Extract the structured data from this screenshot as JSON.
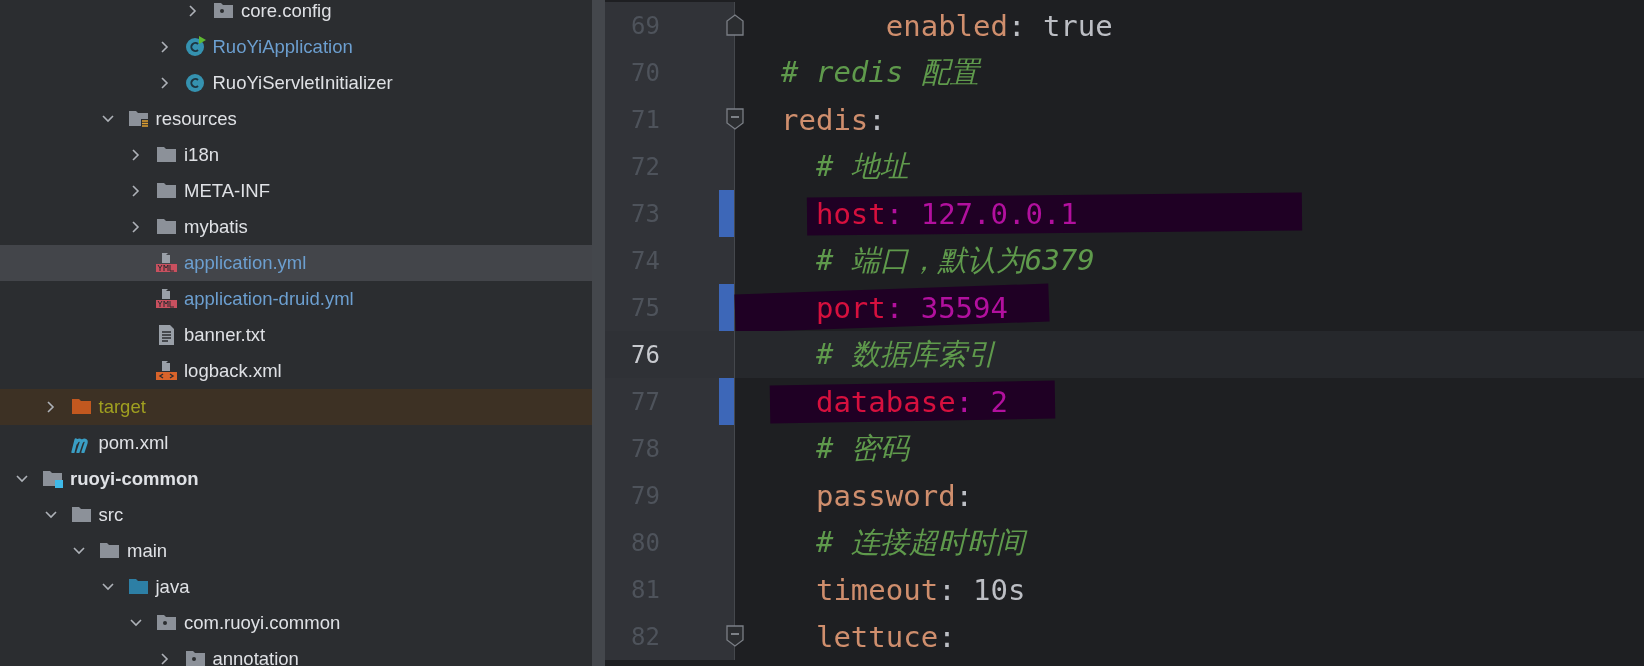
{
  "project_tree": {
    "items": [
      {
        "children": [
          {
            "children": [
              {
                "children": [
                  {
                    "children": [
                      {
                        "children": [
                          {
                            "children": [
                              {
                                "label": "core.config",
                                "kind": "package",
                                "expanded": false,
                                "selected": false,
                                "modified": false
                              }
                            ]
                          },
                          {
                            "label": "RuoYiApplication",
                            "kind": "main-class",
                            "expanded": false,
                            "selected": false,
                            "modified": true
                          },
                          {
                            "label": "RuoYiServletInitializer",
                            "kind": "class",
                            "expanded": false,
                            "selected": false,
                            "modified": false
                          }
                        ]
                      }
                    ]
                  },
                  {
                    "label": "resources",
                    "kind": "resources",
                    "expanded": true,
                    "selected": false,
                    "modified": false,
                    "children": [
                      {
                        "label": "i18n",
                        "kind": "folder",
                        "expanded": false,
                        "selected": false,
                        "modified": false
                      },
                      {
                        "label": "META-INF",
                        "kind": "folder",
                        "expanded": false,
                        "selected": false,
                        "modified": false
                      },
                      {
                        "label": "mybatis",
                        "kind": "folder",
                        "expanded": false,
                        "selected": false,
                        "modified": false
                      },
                      {
                        "label": "application.yml",
                        "kind": "yml",
                        "selected": true,
                        "modified": true
                      },
                      {
                        "label": "application-druid.yml",
                        "kind": "yml",
                        "selected": false,
                        "modified": true
                      },
                      {
                        "label": "banner.txt",
                        "kind": "text",
                        "selected": false,
                        "modified": false
                      },
                      {
                        "label": "logback.xml",
                        "kind": "xml",
                        "selected": false,
                        "modified": false
                      }
                    ]
                  }
                ]
              }
            ]
          },
          {
            "label": "target",
            "kind": "excluded",
            "expanded": false,
            "selected": false,
            "modified": false
          },
          {
            "label": "pom.xml",
            "kind": "maven",
            "selected": false,
            "modified": false
          }
        ]
      },
      {
        "label": "ruoyi-common",
        "kind": "module",
        "expanded": true,
        "selected": false,
        "modified": false,
        "children": [
          {
            "label": "src",
            "kind": "folder",
            "expanded": true,
            "selected": false,
            "modified": false,
            "children": [
              {
                "label": "main",
                "kind": "folder",
                "expanded": true,
                "selected": false,
                "modified": false,
                "children": [
                  {
                    "label": "java",
                    "kind": "source-root",
                    "expanded": true,
                    "selected": false,
                    "modified": false,
                    "children": [
                      {
                        "label": "com.ruoyi.common",
                        "kind": "package",
                        "expanded": true,
                        "selected": false,
                        "modified": false,
                        "children": [
                          {
                            "label": "annotation",
                            "kind": "package",
                            "expanded": false,
                            "selected": false,
                            "modified": false
                          }
                        ]
                      }
                    ]
                  }
                ]
              }
            ]
          }
        ]
      }
    ]
  },
  "editor": {
    "lines": [
      {
        "number": "69",
        "current": false,
        "changed": false,
        "fold_end": true,
        "redacted": false,
        "parts": [
          {
            "kind": "key",
            "text": "      enabled"
          },
          {
            "kind": "punct",
            "text": ": "
          },
          {
            "kind": "value",
            "text": "true"
          }
        ]
      },
      {
        "number": "70",
        "current": false,
        "changed": false,
        "redacted": false,
        "parts": [
          {
            "kind": "comment",
            "text": "# redis 配置"
          }
        ]
      },
      {
        "number": "71",
        "current": false,
        "changed": false,
        "fold_start": true,
        "redacted": false,
        "parts": [
          {
            "kind": "key",
            "text": "redis"
          },
          {
            "kind": "punct",
            "text": ":"
          }
        ]
      },
      {
        "number": "72",
        "current": false,
        "changed": false,
        "redacted": false,
        "parts": [
          {
            "kind": "comment",
            "text": "  # 地址"
          }
        ]
      },
      {
        "number": "73",
        "current": false,
        "changed": true,
        "redacted": true,
        "parts": [
          {
            "kind": "key",
            "text": "  host"
          },
          {
            "kind": "punct",
            "text": ": "
          },
          {
            "kind": "value",
            "text": "127.0.0.1"
          }
        ]
      },
      {
        "number": "74",
        "current": false,
        "changed": false,
        "redacted": false,
        "parts": [
          {
            "kind": "comment",
            "text": "  # 端口，默认为6379"
          }
        ]
      },
      {
        "number": "75",
        "current": false,
        "changed": true,
        "redacted": true,
        "parts": [
          {
            "kind": "key",
            "text": "  port"
          },
          {
            "kind": "punct",
            "text": ": "
          },
          {
            "kind": "value",
            "text": "35594"
          }
        ]
      },
      {
        "number": "76",
        "current": true,
        "changed": false,
        "redacted": false,
        "parts": [
          {
            "kind": "comment",
            "text": "  # 数据库索引"
          }
        ]
      },
      {
        "number": "77",
        "current": false,
        "changed": true,
        "redacted": true,
        "parts": [
          {
            "kind": "key",
            "text": "  database"
          },
          {
            "kind": "punct",
            "text": ": "
          },
          {
            "kind": "value",
            "text": "2"
          }
        ]
      },
      {
        "number": "78",
        "current": false,
        "changed": false,
        "redacted": false,
        "parts": [
          {
            "kind": "comment",
            "text": "  # 密码"
          }
        ]
      },
      {
        "number": "79",
        "current": false,
        "changed": false,
        "redacted": false,
        "parts": [
          {
            "kind": "key",
            "text": "  password"
          },
          {
            "kind": "punct",
            "text": ":"
          }
        ]
      },
      {
        "number": "80",
        "current": false,
        "changed": false,
        "redacted": false,
        "parts": [
          {
            "kind": "comment",
            "text": "  # 连接超时时间"
          }
        ]
      },
      {
        "number": "81",
        "current": false,
        "changed": false,
        "redacted": false,
        "parts": [
          {
            "kind": "key",
            "text": "  timeout"
          },
          {
            "kind": "punct",
            "text": ": "
          },
          {
            "kind": "value",
            "text": "10s"
          }
        ]
      },
      {
        "number": "82",
        "current": false,
        "changed": false,
        "fold_start": true,
        "redacted": false,
        "parts": [
          {
            "kind": "key",
            "text": "  lettuce"
          },
          {
            "kind": "punct",
            "text": ":"
          }
        ]
      }
    ]
  }
}
